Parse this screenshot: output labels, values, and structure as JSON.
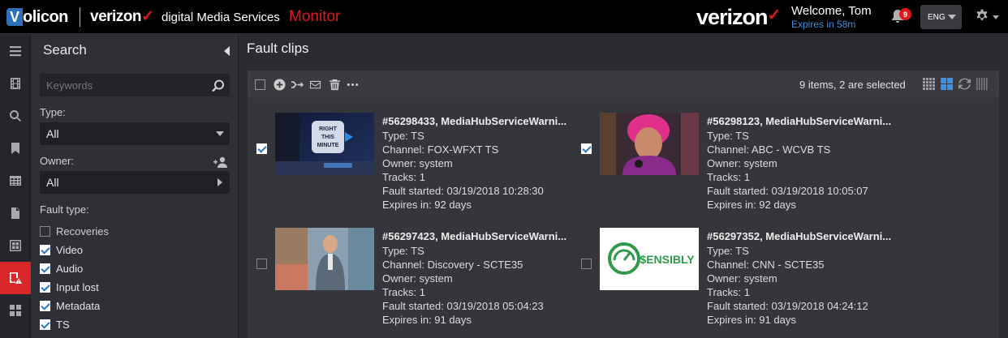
{
  "header": {
    "volicon_logo": "Volicon",
    "brand": "verizon",
    "brand_sub": "digital Media Services",
    "app_name": "Monitor",
    "vz_logo": "verizon",
    "welcome": "Welcome, Tom",
    "expires": "Expires in 58m",
    "notification_count": "9",
    "language": "ENG"
  },
  "colors": {
    "accent_red": "#d8262b",
    "link_blue": "#3f8fe0",
    "check_blue": "#2b74c8"
  },
  "rail": {
    "items": [
      "menu-icon",
      "film-icon",
      "search-icon",
      "bookmark-icon",
      "table-icon",
      "document-icon",
      "grid-window-icon",
      "fault-clips-icon",
      "dashboard-icon"
    ],
    "active": "fault-clips-icon"
  },
  "search": {
    "title": "Search",
    "keywords_placeholder": "Keywords",
    "type_label": "Type:",
    "type_value": "All",
    "owner_label": "Owner:",
    "owner_value": "All",
    "fault_type_label": "Fault type:",
    "fault_types": [
      {
        "label": "Recoveries",
        "checked": false
      },
      {
        "label": "Video",
        "checked": true
      },
      {
        "label": "Audio",
        "checked": true
      },
      {
        "label": "Input lost",
        "checked": true
      },
      {
        "label": "Metadata",
        "checked": true
      },
      {
        "label": "TS",
        "checked": true
      }
    ]
  },
  "main": {
    "title": "Fault clips",
    "toolbar": {
      "count_text": "9 items, 2 are selected",
      "actions": [
        "select-all-checkbox",
        "add-icon",
        "merge-icon",
        "email-icon",
        "delete-icon",
        "more-icon"
      ],
      "views": [
        "grid-small-view-icon",
        "grid-large-view-icon",
        "refresh-icon",
        "filmstrip-view-icon"
      ],
      "active_view": "grid-large-view-icon"
    },
    "clips": [
      {
        "title": "#56298433, MediaHubServiceWarni...",
        "type": "Type: TS",
        "channel": "Channel: FOX-WFXT TS",
        "owner": "Owner: system",
        "tracks": "Tracks: 1",
        "fault_started": "Fault started: 03/19/2018 10:28:30",
        "expires": "Expires in: 92 days",
        "checked": true,
        "thumb_text": "RIGHT THIS MINUTE"
      },
      {
        "title": "#56298123, MediaHubServiceWarni...",
        "type": "Type: TS",
        "channel": "Channel: ABC - WCVB TS",
        "owner": "Owner: system",
        "tracks": "Tracks: 1",
        "fault_started": "Fault started: 03/19/2018 10:05:07",
        "expires": "Expires in: 92 days",
        "checked": true,
        "thumb_text": ""
      },
      {
        "title": "#56297423, MediaHubServiceWarni...",
        "type": "Type: TS",
        "channel": "Channel: Discovery - SCTE35",
        "owner": "Owner: system",
        "tracks": "Tracks: 1",
        "fault_started": "Fault started: 03/19/2018 05:04:23",
        "expires": "Expires in: 91 days",
        "checked": false,
        "thumb_text": ""
      },
      {
        "title": "#56297352, MediaHubServiceWarni...",
        "type": "Type: TS",
        "channel": "Channel: CNN - SCTE35",
        "owner": "Owner: system",
        "tracks": "Tracks: 1",
        "fault_started": "Fault started: 03/19/2018 04:24:12",
        "expires": "Expires in: 91 days",
        "checked": false,
        "thumb_text": "$ENSIBLY"
      }
    ]
  }
}
